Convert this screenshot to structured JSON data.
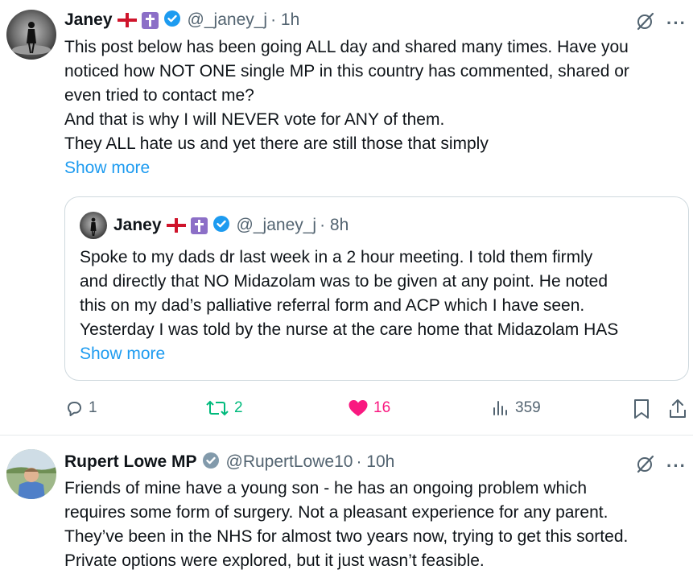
{
  "post1": {
    "author_name": "Janey",
    "handle": "@_janey_j",
    "time": "· 1h",
    "lines": [
      "This post below has been going ALL day and shared many times.  Have you",
      "noticed how NOT ONE single MP in this country has commented, shared or",
      "even tried to contact me?",
      "And that is why I will NEVER vote for ANY of them.",
      "They ALL hate us and yet there are still those that simply"
    ],
    "show_more": "Show more",
    "quoted": {
      "author_name": "Janey",
      "handle": "@_janey_j",
      "time": "· 8h",
      "lines": [
        "Spoke to my dads dr last week in a 2 hour meeting.  I told them firmly",
        "and directly that NO Midazolam was to be given at any point. He noted",
        "this on my dad’s palliative referral form and ACP which I have seen.",
        "Yesterday I was told by the nurse at the care home that Midazolam HAS"
      ],
      "show_more": "Show more"
    },
    "actions": {
      "replies": "1",
      "reposts": "2",
      "likes": "16",
      "views": "359"
    }
  },
  "post2": {
    "author_name": "Rupert Lowe MP",
    "handle": "@RupertLowe10",
    "time": "· 10h",
    "lines": [
      "Friends of mine have a young son - he has an ongoing problem which",
      "requires some form of surgery. Not a pleasant experience for any parent.",
      "They’ve been in the NHS for almost two years now, trying to get this sorted.",
      "Private options were explored, but it just wasn’t feasible."
    ]
  },
  "icons": {
    "more": "···",
    "verified_blue": "#1d9bf0",
    "verified_gray": "#829aab",
    "repost_color": "#00ba7c",
    "like_color": "#f91880",
    "link_color": "#1d9bf0"
  }
}
